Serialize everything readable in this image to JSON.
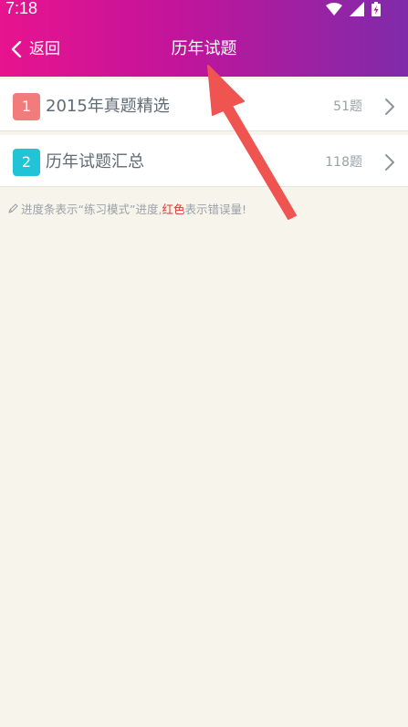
{
  "status_bar": {
    "time": "7:18"
  },
  "header": {
    "back_label": "返回",
    "title": "历年试题"
  },
  "list": [
    {
      "index": "1",
      "title": "2015年真题精选",
      "count": "51题",
      "badge_color": "#f27c7c"
    },
    {
      "index": "2",
      "title": "历年试题汇总",
      "count": "118题",
      "badge_color": "#21c4d7"
    }
  ],
  "hint": {
    "prefix": "进度条表示“练习模式”进度,",
    "red": "红色",
    "suffix": "表示错误量!"
  },
  "colors": {
    "header_start": "#e8138f",
    "header_end": "#7f2ba9",
    "background": "#f7f4ec",
    "arrow": "#ef5450",
    "accent_red": "#e0362c"
  }
}
